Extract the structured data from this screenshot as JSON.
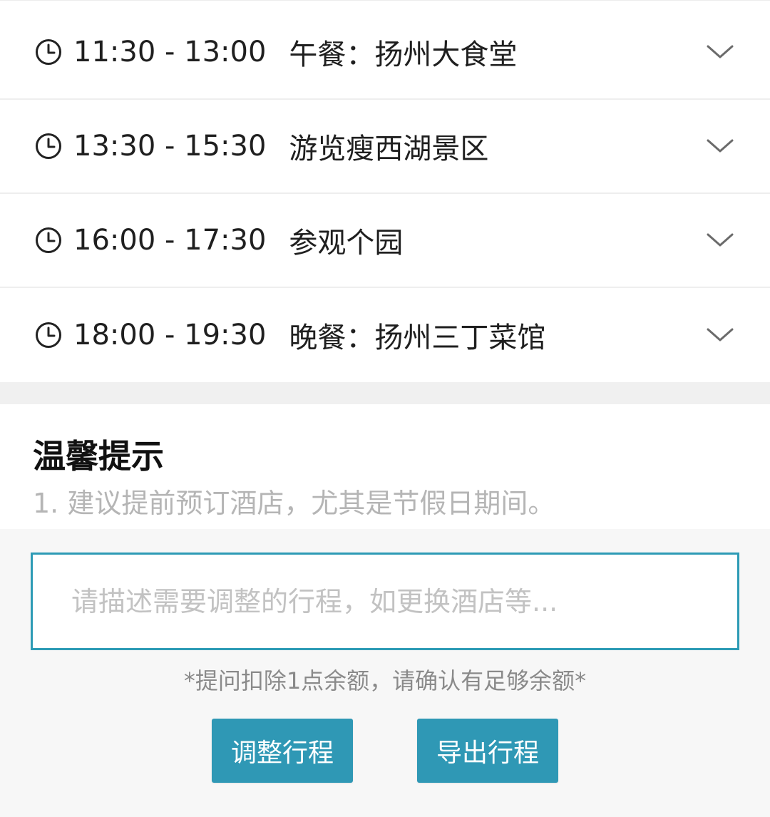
{
  "itinerary": {
    "items": [
      {
        "time": "11:30 - 13:00",
        "title": "午餐：扬州大食堂",
        "icon": "clock-icon",
        "expand_icon": "chevron-down-icon"
      },
      {
        "time": "13:30 - 15:30",
        "title": "游览瘦西湖景区",
        "icon": "clock-icon",
        "expand_icon": "chevron-down-icon"
      },
      {
        "time": "16:00 - 17:30",
        "title": "参观个园",
        "icon": "clock-icon",
        "expand_icon": "chevron-down-icon"
      },
      {
        "time": "18:00 - 19:30",
        "title": "晚餐：扬州三丁菜馆",
        "icon": "clock-icon",
        "expand_icon": "chevron-down-icon"
      }
    ]
  },
  "tips": {
    "title": "温馨提示",
    "lines": [
      "1. 建议提前预订酒店，尤其是节假日期间。"
    ]
  },
  "input": {
    "placeholder": "请描述需要调整的行程，如更换酒店等...",
    "value": ""
  },
  "notice": "*提问扣除1点余额，请确认有足够余额*",
  "buttons": {
    "adjust_label": "调整行程",
    "export_label": "导出行程"
  },
  "colors": {
    "accent": "#2f98b5",
    "input_border": "#2d9bb5",
    "tips_text": "#b5b5b5",
    "notice_text": "#8a8a8a"
  }
}
